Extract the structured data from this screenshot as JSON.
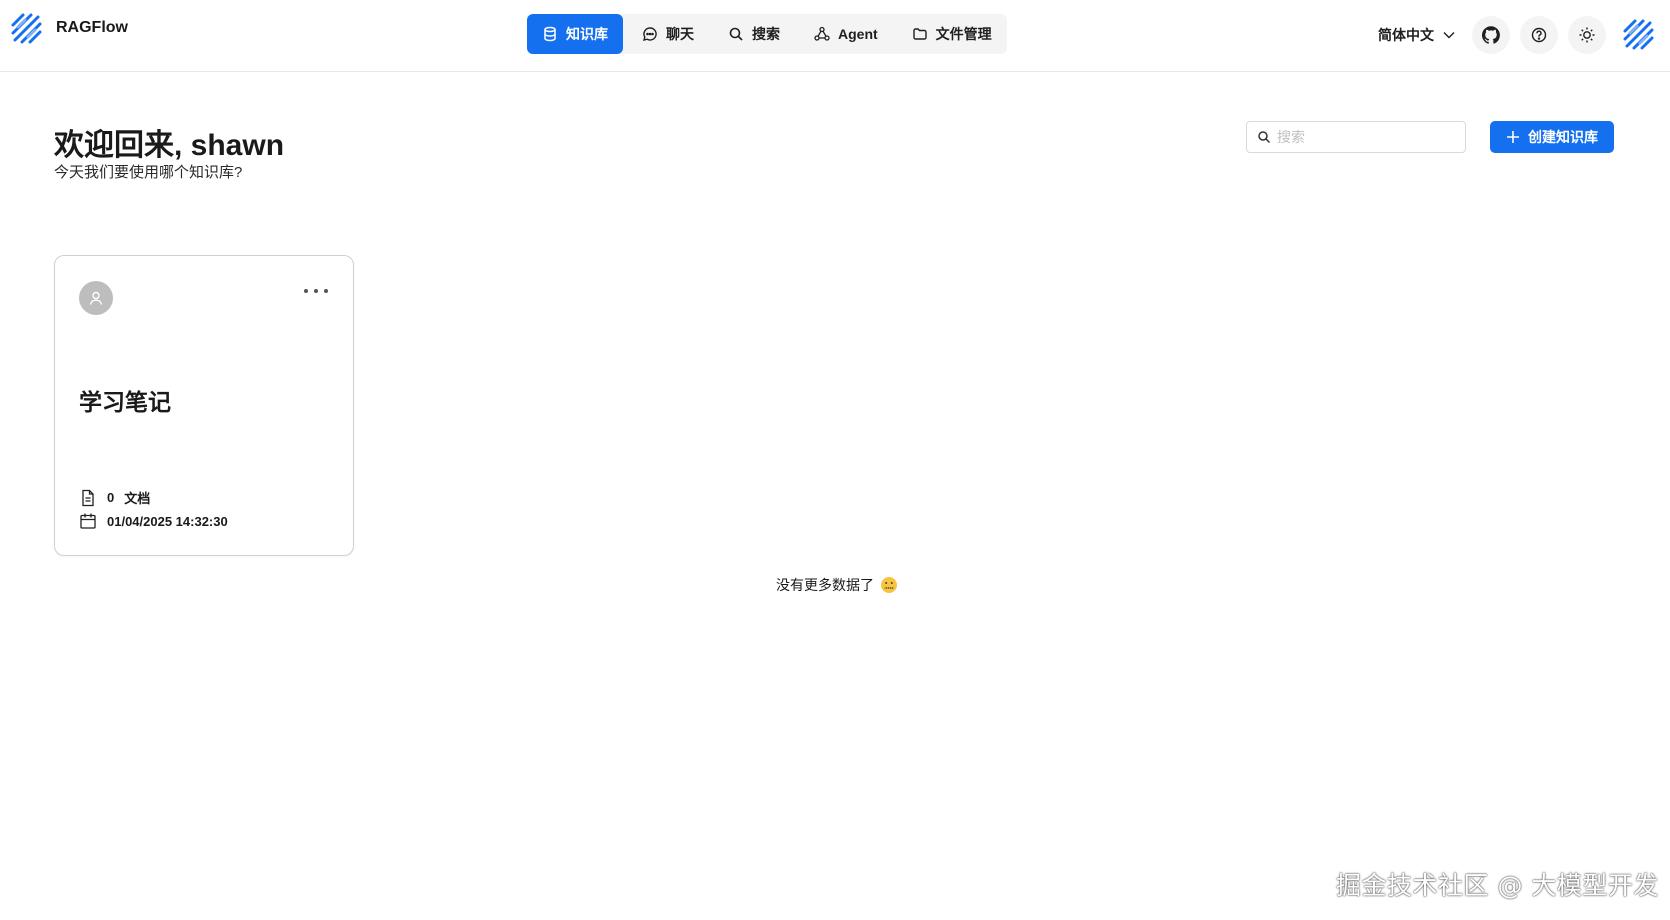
{
  "app": {
    "name": "RAGFlow"
  },
  "nav": {
    "items": [
      {
        "label": "知识库",
        "icon": "database-icon",
        "active": true
      },
      {
        "label": "聊天",
        "icon": "chat-bubble-icon",
        "active": false
      },
      {
        "label": "搜索",
        "icon": "search-icon",
        "active": false
      },
      {
        "label": "Agent",
        "icon": "graph-nodes-icon",
        "active": false
      },
      {
        "label": "文件管理",
        "icon": "folder-icon",
        "active": false
      }
    ]
  },
  "toolbar": {
    "language": "简体中文",
    "icons": [
      "github-icon",
      "help-circle-icon",
      "sun-icon",
      "user-avatar"
    ]
  },
  "welcome": {
    "title": "欢迎回来, shawn",
    "subtitle": "今天我们要使用哪个知识库?"
  },
  "search": {
    "placeholder": "搜索",
    "value": ""
  },
  "create_button": {
    "label": "创建知识库"
  },
  "knowledge_bases": [
    {
      "title": "学习笔记",
      "doc_count": "0",
      "doc_unit": "文档",
      "updated": "01/04/2025 14:32:30"
    }
  ],
  "list_footer": {
    "text": "没有更多数据了"
  },
  "watermark": {
    "text": "掘金技术社区 @ 大模型开发"
  },
  "colors": {
    "accent": "#1570ef",
    "nav_bg": "#f4f4f5",
    "border": "#e8e8e8"
  }
}
